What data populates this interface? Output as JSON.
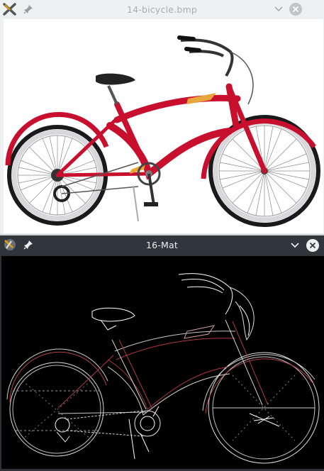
{
  "windows": [
    {
      "title": "14-bicycle.bmp",
      "state": "inactive"
    },
    {
      "title": "16-Mat",
      "state": "active"
    }
  ],
  "icons": {
    "app": "xk-app-icon",
    "pin": "pin-icon",
    "minimize": "chevron-down-icon",
    "close": "close-icon"
  },
  "colors": {
    "frame_red": "#c8102e",
    "edge_red": "#b0383f",
    "titlebar_dark": "#31363b",
    "titlebar_light": "#eff0f1"
  },
  "images": {
    "source": "bicycle-photo",
    "result": "edge-map"
  }
}
